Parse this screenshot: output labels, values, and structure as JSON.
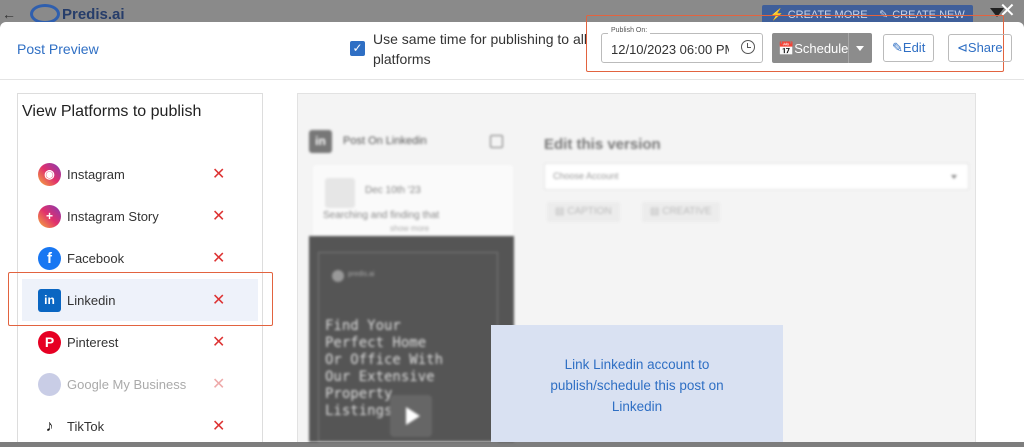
{
  "topbar": {
    "back_icon": "arrow-left-icon",
    "logo_text": "Predis.ai",
    "create_more": "CREATE MORE",
    "create_new": "CREATE NEW",
    "filter_icon": "filter-icon",
    "close_icon": "close-icon"
  },
  "header": {
    "title": "Post Preview",
    "same_time_checked": true,
    "same_time_label": "Use same time for publishing to all platforms",
    "publish_on_label": "Publish On:",
    "publish_on_value": "12/10/2023 06:00 PM",
    "schedule_label": "Schedule",
    "edit_label": "Edit",
    "share_label": "Share"
  },
  "sidebar": {
    "title": "View Platforms to publish",
    "items": [
      {
        "label": "Instagram",
        "icon": "instagram-icon",
        "active": false,
        "enabled": true
      },
      {
        "label": "Instagram Story",
        "icon": "instagram-story-icon",
        "active": false,
        "enabled": true
      },
      {
        "label": "Facebook",
        "icon": "facebook-icon",
        "active": false,
        "enabled": true
      },
      {
        "label": "Linkedin",
        "icon": "linkedin-icon",
        "active": true,
        "enabled": true
      },
      {
        "label": "Pinterest",
        "icon": "pinterest-icon",
        "active": false,
        "enabled": true
      },
      {
        "label": "Google My Business",
        "icon": "google-my-business-icon",
        "active": false,
        "enabled": false
      },
      {
        "label": "TikTok",
        "icon": "tiktok-icon",
        "active": false,
        "enabled": true
      }
    ]
  },
  "preview": {
    "post_on_label": "Post On Linkedin",
    "card_date": "Dec 10th '23",
    "card_text": "Searching and finding that",
    "card_more": "show more",
    "image_brand": "predis.ai",
    "image_text": "Find Your Perfect Home Or Office With Our Extensive Property Listings",
    "edit_title": "Edit this version",
    "choose_account_placeholder": "Choose Account",
    "caption_tab": "CAPTION",
    "creative_tab": "CREATIVE",
    "overlay_message": "Link Linkedin account to publish/schedule this post on Linkedin"
  },
  "colors": {
    "accent": "#2f6fc4",
    "highlight_border": "#e2633f",
    "remove_x": "#d33333"
  }
}
